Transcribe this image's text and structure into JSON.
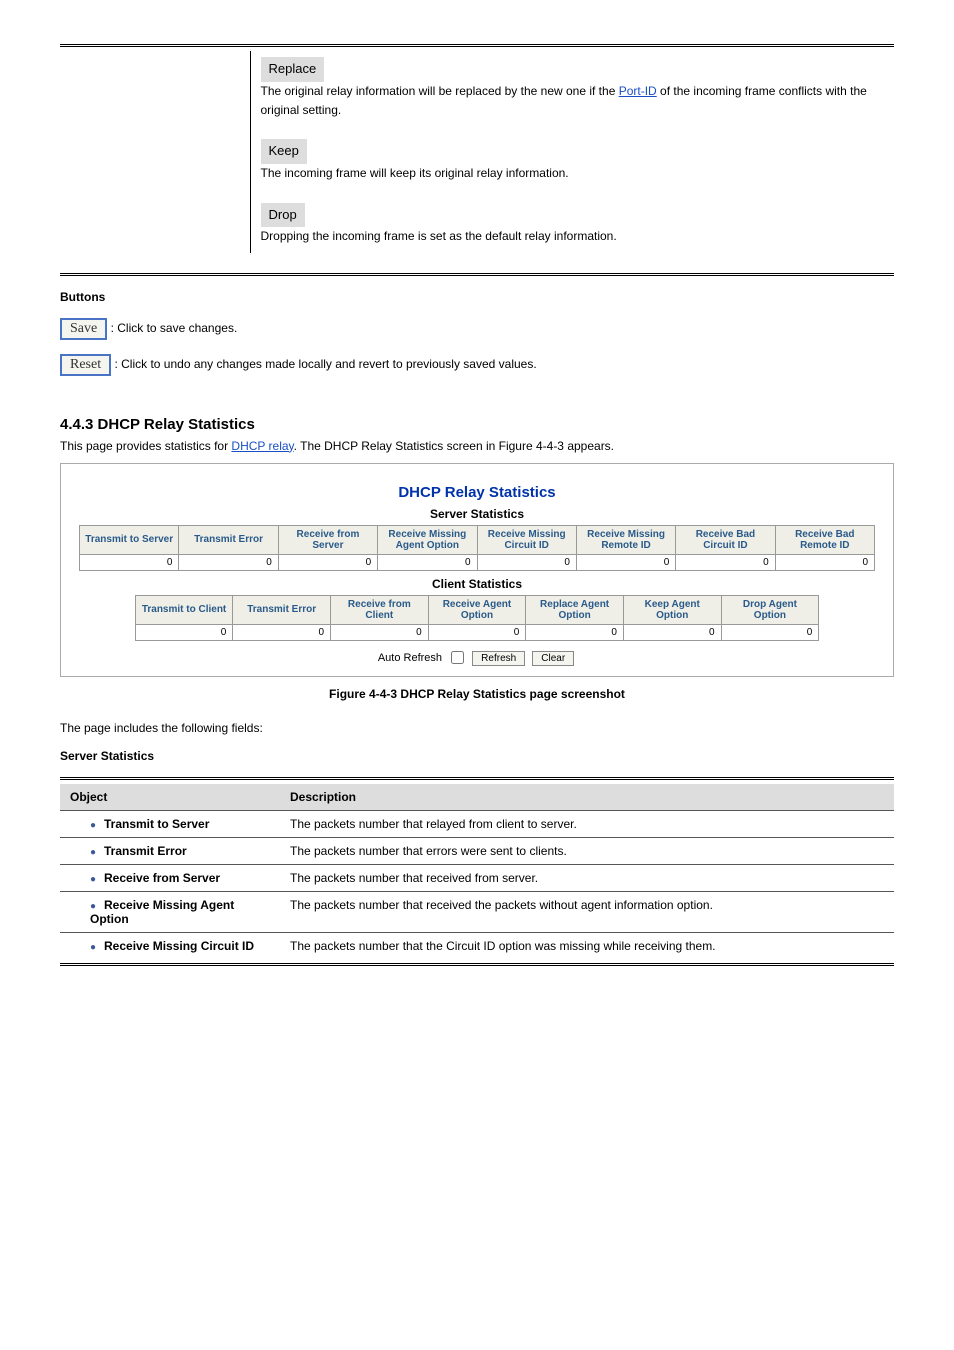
{
  "top_table": {
    "replace": {
      "label": "Replace",
      "desc_before": "The original relay information will be replaced by the new one if the ",
      "desc_link": "Port-ID",
      "desc_after": " of the incoming frame conflicts with the original setting."
    },
    "keep": {
      "label": "Keep",
      "desc": "The incoming frame will keep its original relay information."
    },
    "drop": {
      "label": "Drop",
      "desc": "Dropping the incoming frame is set as the default relay information."
    }
  },
  "buttons_intro": "Buttons",
  "save_btn": "Save",
  "save_desc": ": Click to save changes.",
  "reset_btn": "Reset",
  "reset_desc": ": Click to undo any changes made locally and revert to previously saved values.",
  "section_num": "4.4.3 DHCP Relay Statistics",
  "section_desc_before": "This page provides statistics for ",
  "section_desc_link": "DHCP relay",
  "section_desc_after": ". The DHCP Relay Statistics screen in Figure 4-4-3 appears.",
  "fig": {
    "title": "DHCP Relay Statistics",
    "server_sub": "Server Statistics",
    "server_headers": [
      "Transmit to Server",
      "Transmit Error",
      "Receive from Server",
      "Receive Missing Agent Option",
      "Receive Missing Circuit ID",
      "Receive Missing Remote ID",
      "Receive Bad Circuit ID",
      "Receive Bad Remote ID"
    ],
    "server_row": [
      "0",
      "0",
      "0",
      "0",
      "0",
      "0",
      "0",
      "0"
    ],
    "client_sub": "Client Statistics",
    "client_headers": [
      "Transmit to Client",
      "Transmit Error",
      "Receive from Client",
      "Receive Agent Option",
      "Replace Agent Option",
      "Keep Agent Option",
      "Drop Agent Option"
    ],
    "client_row": [
      "0",
      "0",
      "0",
      "0",
      "0",
      "0",
      "0"
    ],
    "auto_refresh": "Auto Refresh",
    "refresh_btn": "Refresh",
    "clear_btn": "Clear"
  },
  "fig_caption": "Figure 4-4-3 DHCP Relay Statistics page screenshot",
  "page_lead": "The page includes the following fields:",
  "server_stats_label": "Server Statistics",
  "tbl": {
    "h1": "Object",
    "h2": "Description",
    "rows": [
      {
        "obj": "Transmit to Server",
        "desc": "The packets number that relayed from client to server."
      },
      {
        "obj": "Transmit Error",
        "desc": "The packets number that errors were sent to clients."
      },
      {
        "obj": "Receive from Server",
        "desc": "The packets number that received from server."
      },
      {
        "obj": "Receive Missing Agent Option",
        "desc": "The packets number that received the packets without agent information option."
      },
      {
        "obj": "Receive Missing Circuit ID",
        "desc": "The packets number that the Circuit ID option was missing while receiving them."
      }
    ]
  }
}
